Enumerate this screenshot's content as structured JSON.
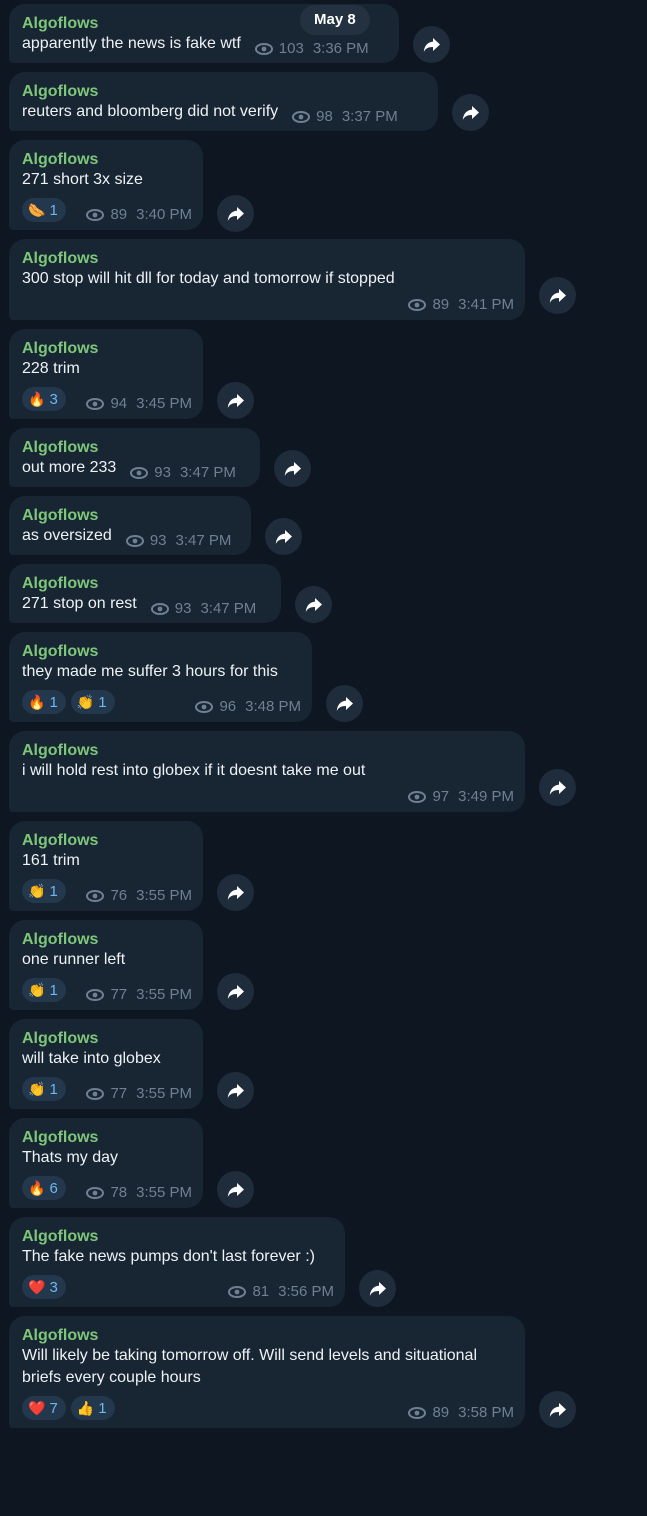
{
  "date_badge": "May 8",
  "sender": "Algoflows",
  "messages": [
    {
      "text": "apparently the news is fake wtf",
      "views": "103",
      "time": "3:36 PM",
      "reactions": []
    },
    {
      "text": "reuters and bloomberg did not verify",
      "views": "98",
      "time": "3:37 PM",
      "reactions": []
    },
    {
      "text": "271 short 3x size",
      "views": "89",
      "time": "3:40 PM",
      "reactions": [
        {
          "emoji": "🌭",
          "count": "1"
        }
      ]
    },
    {
      "text": "300 stop will hit dll for today and tomorrow if stopped",
      "views": "89",
      "time": "3:41 PM",
      "reactions": []
    },
    {
      "text": "228 trim",
      "views": "94",
      "time": "3:45 PM",
      "reactions": [
        {
          "emoji": "🔥",
          "count": "3"
        }
      ]
    },
    {
      "text": "out more 233",
      "views": "93",
      "time": "3:47 PM",
      "reactions": []
    },
    {
      "text": "as oversized",
      "views": "93",
      "time": "3:47 PM",
      "reactions": []
    },
    {
      "text": "271 stop on rest",
      "views": "93",
      "time": "3:47 PM",
      "reactions": []
    },
    {
      "text": "they made me suffer 3 hours for this",
      "views": "96",
      "time": "3:48 PM",
      "reactions": [
        {
          "emoji": "🔥",
          "count": "1"
        },
        {
          "emoji": "👏",
          "count": "1"
        }
      ]
    },
    {
      "text": "i will hold rest into globex if it doesnt take me out",
      "views": "97",
      "time": "3:49 PM",
      "reactions": []
    },
    {
      "text": "161 trim",
      "views": "76",
      "time": "3:55 PM",
      "reactions": [
        {
          "emoji": "👏",
          "count": "1"
        }
      ]
    },
    {
      "text": "one runner left",
      "views": "77",
      "time": "3:55 PM",
      "reactions": [
        {
          "emoji": "👏",
          "count": "1"
        }
      ]
    },
    {
      "text": "will take into globex",
      "views": "77",
      "time": "3:55 PM",
      "reactions": [
        {
          "emoji": "👏",
          "count": "1"
        }
      ]
    },
    {
      "text": "Thats my day",
      "views": "78",
      "time": "3:55 PM",
      "reactions": [
        {
          "emoji": "🔥",
          "count": "6"
        }
      ]
    },
    {
      "text": "The fake news pumps don't last forever :)",
      "views": "81",
      "time": "3:56 PM",
      "reactions": [
        {
          "emoji": "❤️",
          "count": "3"
        }
      ]
    },
    {
      "text": "Will likely be taking tomorrow off. Will send levels and situational briefs every couple hours",
      "views": "89",
      "time": "3:58 PM",
      "reactions": [
        {
          "emoji": "❤️",
          "count": "7"
        },
        {
          "emoji": "👍",
          "count": "1"
        }
      ]
    }
  ],
  "colors": {
    "background": "#0e1621",
    "bubble": "#182533",
    "sender": "#7ec67a",
    "meta": "#6e8092",
    "reaction_bg": "#23374d",
    "reaction_text": "#6fb6f0"
  },
  "icons": {
    "views": "eye-icon",
    "forward": "forward-arrow-icon"
  }
}
